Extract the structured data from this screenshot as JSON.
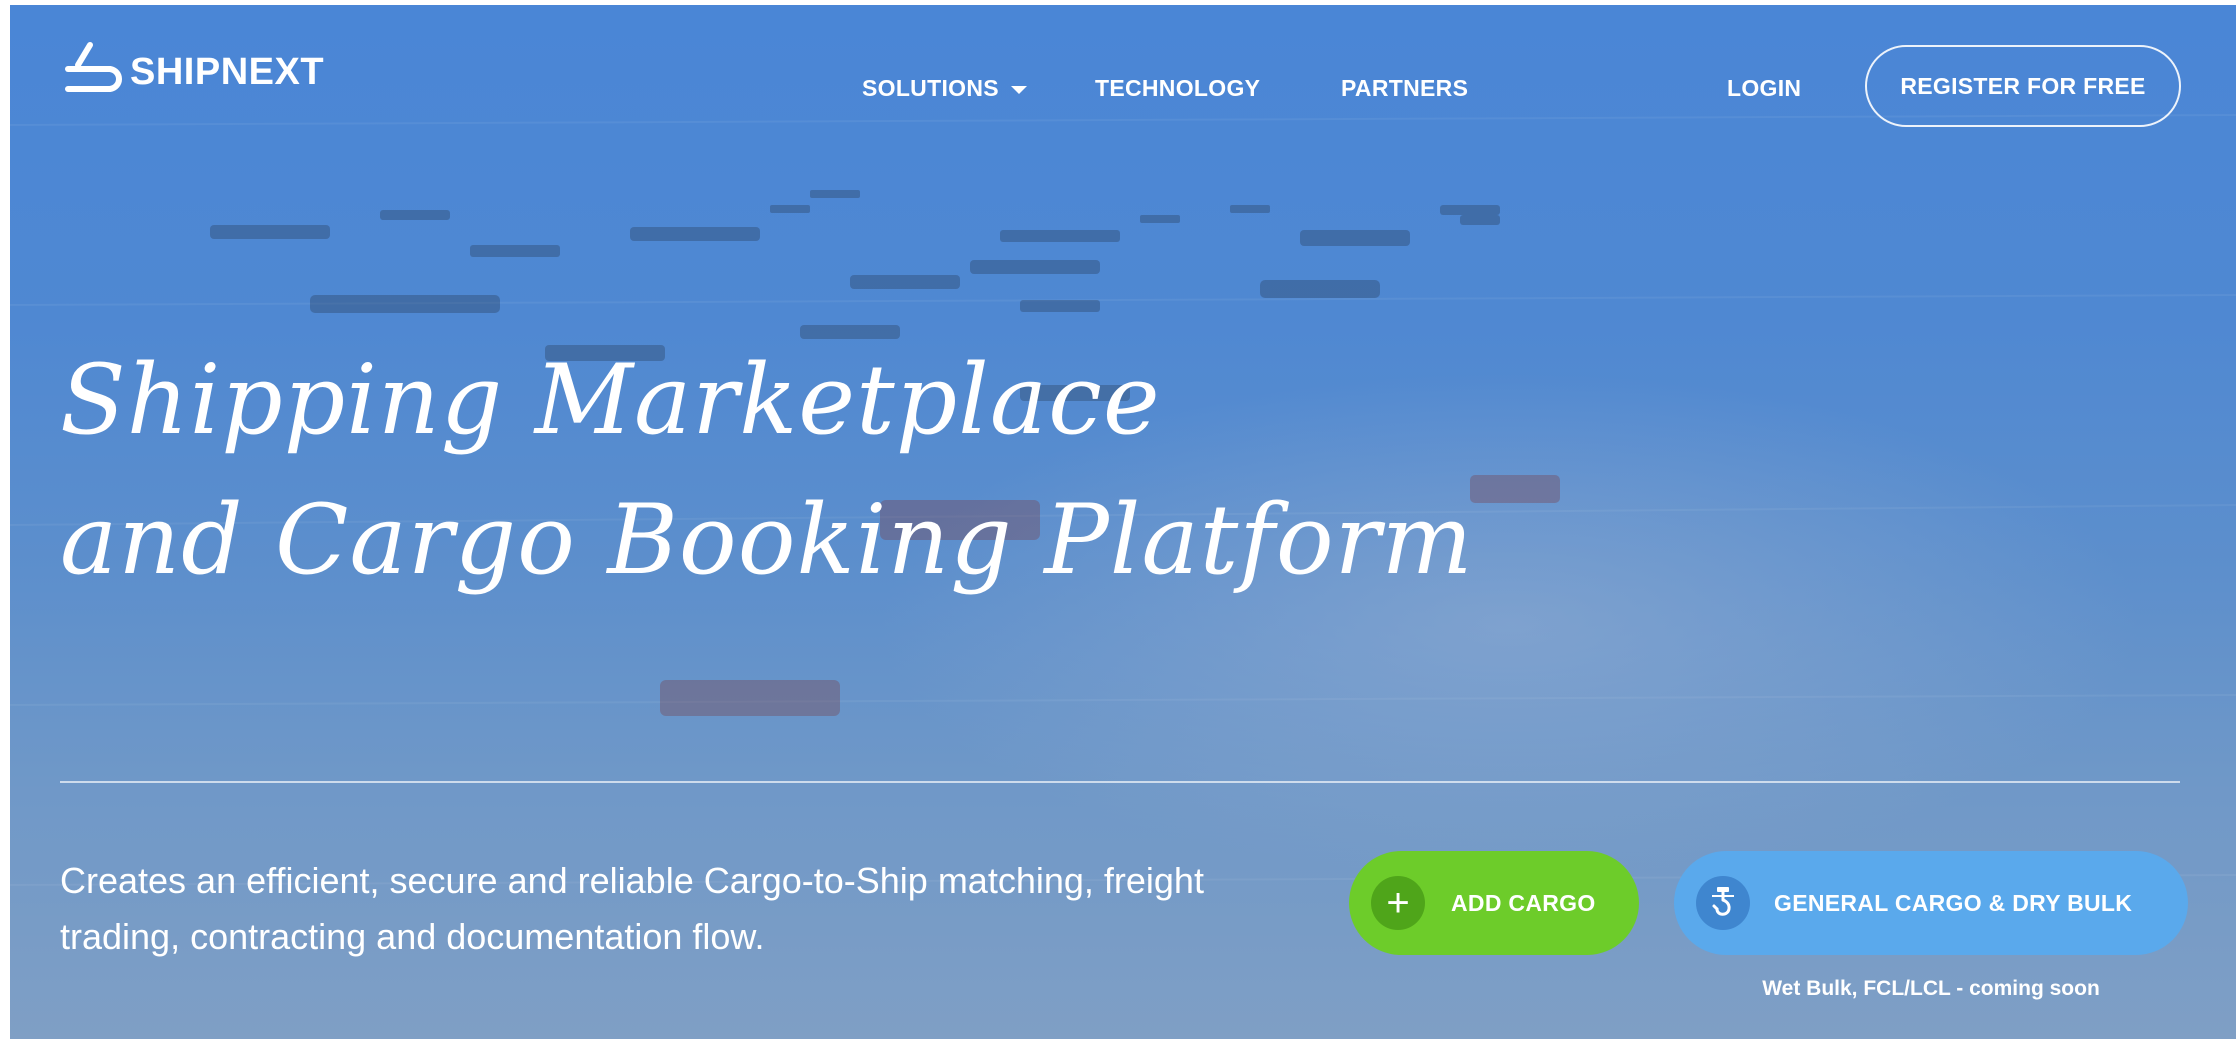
{
  "brand": {
    "name": "SHIPNEXT",
    "logo_icon": "shipnext-logo-mark"
  },
  "nav": {
    "solutions": "SOLUTIONS",
    "technology": "TECHNOLOGY",
    "partners": "PARTNERS",
    "login": "LOGIN",
    "register": "REGISTER FOR FREE"
  },
  "hero": {
    "headline_line1": "Shipping Marketplace",
    "headline_line2": "and Cargo Booking Platform",
    "tagline": "Creates an efficient, secure and reliable Cargo-to-Ship matching, freight trading, contracting and documentation flow."
  },
  "actions": {
    "add_cargo": {
      "label": "ADD CARGO",
      "icon": "plus-icon",
      "color": "#6dcc2a"
    },
    "general_cargo": {
      "label": "GENERAL CARGO & DRY BULK",
      "icon": "crane-hook-icon",
      "color": "#5aa9ec"
    },
    "note": "Wet Bulk, FCL/LCL - coming soon"
  },
  "colors": {
    "background": "#4f88d2",
    "text": "#ffffff"
  }
}
